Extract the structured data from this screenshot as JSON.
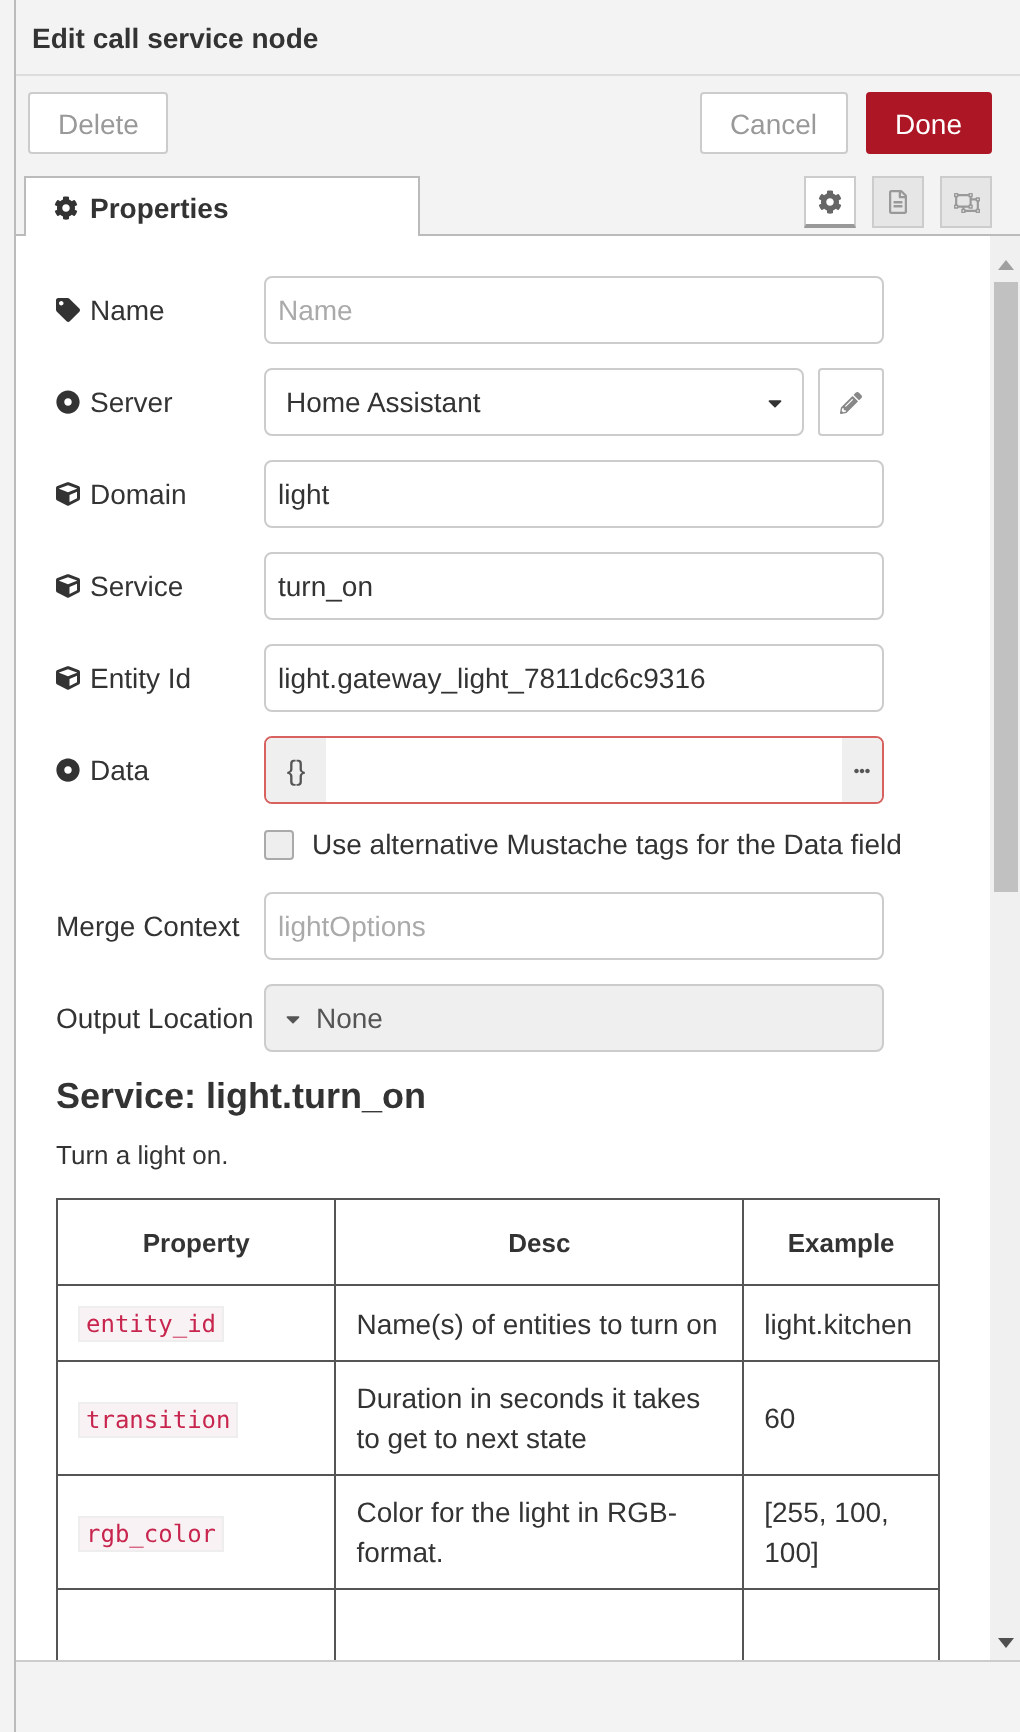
{
  "dialog": {
    "title": "Edit call service node"
  },
  "buttons": [
    {
      "label": "Delete",
      "kind": "plain"
    },
    {
      "label": "Cancel",
      "kind": "plain"
    },
    {
      "label": "Done",
      "kind": "primary"
    }
  ],
  "tabs": [
    {
      "label": "Properties",
      "selected": true
    }
  ],
  "tab_icons": [
    {
      "kind": "settings",
      "selected": true
    },
    {
      "kind": "description",
      "selected": false
    },
    {
      "kind": "appearance",
      "selected": false
    }
  ],
  "form": [
    {
      "kind": "text",
      "label": "Name",
      "placeholder": "Name"
    },
    {
      "kind": "select",
      "label": "Server",
      "value": "Home Assistant"
    },
    {
      "kind": "text",
      "label": "Domain",
      "value": "light"
    },
    {
      "kind": "text",
      "label": "Service",
      "value": "turn_on"
    },
    {
      "kind": "text",
      "label": "Entity Id",
      "value": "light.gateway_light_7811dc6c9316"
    },
    {
      "kind": "typed",
      "label": "Data",
      "type_label": "{}",
      "invalid": true
    },
    {
      "kind": "checkbox",
      "label": "Use alternative Mustache tags for the Data field",
      "checked": false
    },
    {
      "kind": "text",
      "label": "Merge Context",
      "placeholder": "lightOptions"
    },
    {
      "kind": "dropdown",
      "label": "Output Location",
      "value": "None"
    }
  ],
  "service_doc": {
    "heading": "Service: light.turn_on",
    "description": "Turn a light on.",
    "columns": [
      "Property",
      "Desc",
      "Example"
    ],
    "rows": [
      {
        "property": "entity_id",
        "desc": "Name(s) of entities to turn on",
        "example": "light.kitchen"
      },
      {
        "property": "transition",
        "desc": "Duration in seconds it takes to get to next state",
        "example": "60"
      },
      {
        "property": "rgb_color",
        "desc": "Color for the light in RGB-format.",
        "example": "[255, 100, 100]"
      }
    ]
  }
}
